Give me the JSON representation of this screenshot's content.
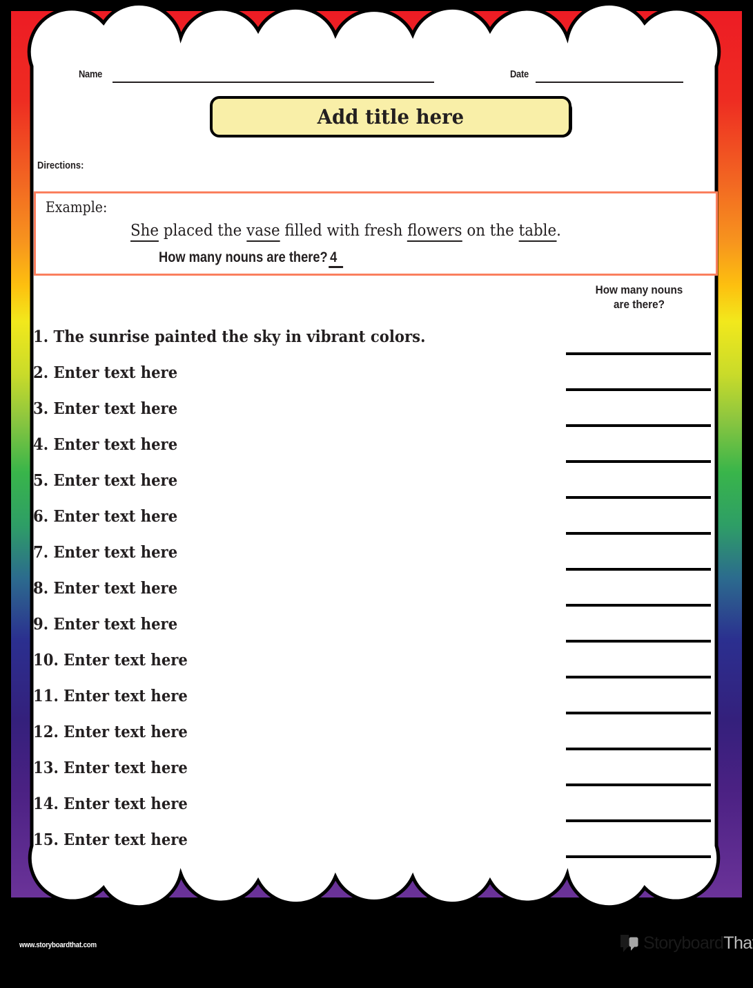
{
  "header": {
    "name_label": "Name",
    "date_label": "Date"
  },
  "title": {
    "text": "Add title here"
  },
  "directions": {
    "label": "Directions:",
    "value": ""
  },
  "example": {
    "label": "Example:",
    "sentence_parts": [
      {
        "text": "She",
        "noun": true
      },
      {
        "text": " placed the ",
        "noun": false
      },
      {
        "text": "vase",
        "noun": true
      },
      {
        "text": " filled with fresh ",
        "noun": false
      },
      {
        "text": "flowers",
        "noun": true
      },
      {
        "text": " on the ",
        "noun": false
      },
      {
        "text": "table",
        "noun": true
      },
      {
        "text": ".",
        "noun": false
      }
    ],
    "question": "How many nouns are there?",
    "answer": "4"
  },
  "answer_column": {
    "header_line1": "How many nouns",
    "header_line2": "are there?"
  },
  "questions": [
    {
      "number": "1.",
      "text": "The sunrise painted the sky in vibrant colors."
    },
    {
      "number": "2.",
      "text": "Enter text here"
    },
    {
      "number": "3.",
      "text": "Enter text here"
    },
    {
      "number": "4.",
      "text": "Enter text here"
    },
    {
      "number": "5.",
      "text": "Enter text here"
    },
    {
      "number": "6.",
      "text": "Enter text here"
    },
    {
      "number": "7.",
      "text": "Enter text here"
    },
    {
      "number": "8.",
      "text": "Enter text here"
    },
    {
      "number": "9.",
      "text": "Enter text here"
    },
    {
      "number": "10.",
      "text": "Enter text here"
    },
    {
      "number": "11.",
      "text": "Enter text here"
    },
    {
      "number": "12.",
      "text": "Enter text here"
    },
    {
      "number": "13.",
      "text": "Enter text here"
    },
    {
      "number": "14.",
      "text": "Enter text here"
    },
    {
      "number": "15.",
      "text": "Enter text here"
    }
  ],
  "footer": {
    "url": "www.storyboardthat.com",
    "logo_primary": "Storyboard",
    "logo_secondary": "That",
    "logo_icon": "speech-bubble-icon"
  },
  "colors": {
    "border_top": "#ED1C24",
    "border_orange": "#F7941E",
    "border_yellow": "#F2E81C",
    "border_green": "#39B54A",
    "border_blue": "#2B2F8F",
    "border_purple": "#6B3399",
    "title_fill": "#F9EFA8",
    "example_border": "#FA7F5E",
    "ink": "#231F20",
    "paper": "#FFFFFF"
  }
}
